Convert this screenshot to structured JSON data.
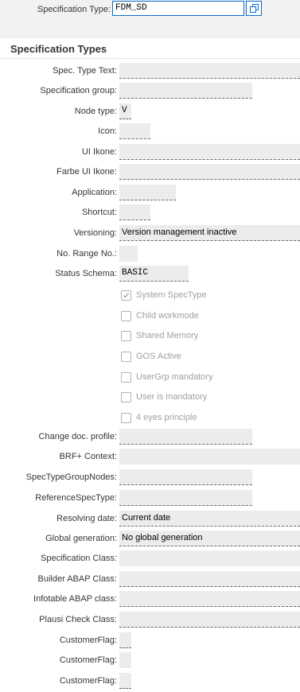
{
  "header": {
    "spec_type_label": "Specification Type:",
    "spec_type_value": "FDM_SD",
    "value_help_icon": "value-help-icon"
  },
  "section": {
    "title": "Specification Types"
  },
  "fields": {
    "spec_type_text": {
      "label": "Spec. Type Text:",
      "value": ""
    },
    "spec_group": {
      "label": "Specification group:",
      "value": ""
    },
    "node_type": {
      "label": "Node type:",
      "value": "V"
    },
    "icon": {
      "label": "Icon:",
      "value": ""
    },
    "ui_ikone": {
      "label": "UI Ikone:",
      "value": ""
    },
    "farbe_ui_ikone": {
      "label": "Farbe UI Ikone:",
      "value": ""
    },
    "application": {
      "label": "Application:",
      "value": ""
    },
    "shortcut": {
      "label": "Shortcut:",
      "value": ""
    },
    "versioning": {
      "label": "Versioning:",
      "value": "Version management inactive"
    },
    "no_range_no": {
      "label": "No. Range No.:",
      "value": ""
    },
    "status_schema": {
      "label": "Status Schema:",
      "value": "BASIC"
    },
    "change_doc_profile": {
      "label": "Change doc. profile:",
      "value": ""
    },
    "brf_context": {
      "label": "BRF+ Context:",
      "value": ""
    },
    "spec_type_group_nodes": {
      "label": "SpecTypeGroupNodes:",
      "value": ""
    },
    "reference_spec_type": {
      "label": "ReferenceSpecType:",
      "value": ""
    },
    "resolving_date": {
      "label": "Resolving date:",
      "value": "Current date"
    },
    "global_generation": {
      "label": "Global generation:",
      "value": "No global generation"
    },
    "specification_class": {
      "label": "Specification Class:",
      "value": ""
    },
    "builder_abap_class": {
      "label": "Builder ABAP Class:",
      "value": ""
    },
    "infotable_abap_class": {
      "label": "Infotable ABAP class:",
      "value": ""
    },
    "plausi_check_class": {
      "label": "Plausi Check Class:",
      "value": ""
    },
    "customer_flag_1": {
      "label": "CustomerFlag:",
      "value": ""
    },
    "customer_flag_2": {
      "label": "CustomerFlag:",
      "value": ""
    },
    "customer_flag_3": {
      "label": "CustomerFlag:",
      "value": ""
    }
  },
  "checkboxes": [
    {
      "label": "System SpecType",
      "checked": true
    },
    {
      "label": "Child workmode",
      "checked": false
    },
    {
      "label": "Shared Memory",
      "checked": false
    },
    {
      "label": "GOS Active",
      "checked": false
    },
    {
      "label": "UserGrp mandatory",
      "checked": false
    },
    {
      "label": "User is mandatory",
      "checked": false
    },
    {
      "label": "4 eyes principle",
      "checked": false
    }
  ],
  "colors": {
    "field_bg": "#ececec",
    "focus_border": "#0a6ed1",
    "disabled_text": "#9da0a3"
  }
}
